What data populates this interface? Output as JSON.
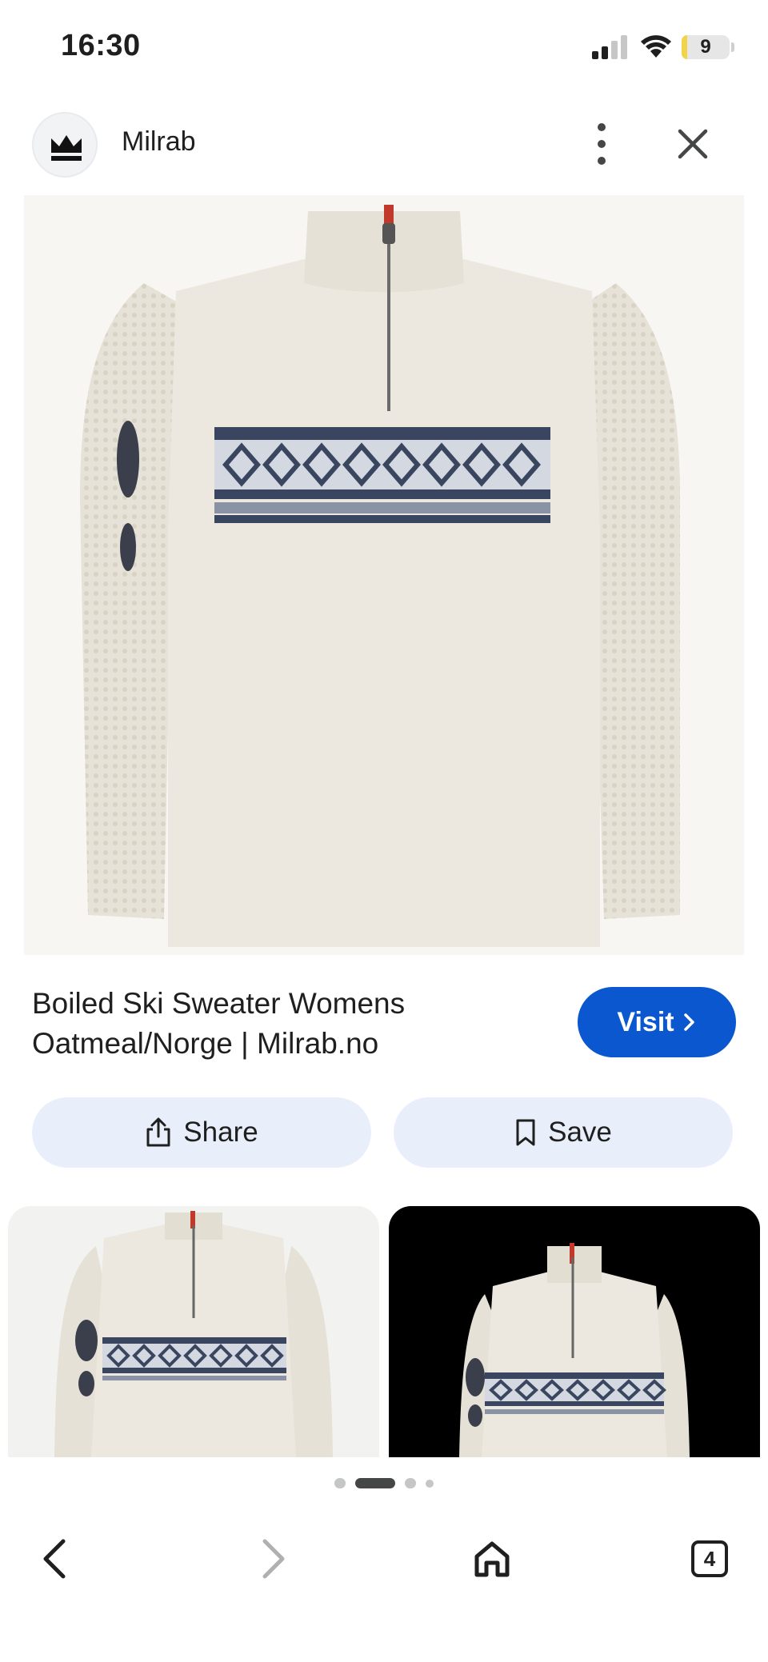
{
  "status_bar": {
    "time": "16:30",
    "battery_level": "9",
    "battery_fraction": 0.09
  },
  "header": {
    "site_name": "Milrab",
    "logo_icon": "mountain-crown-icon",
    "more_icon": "more-vertical-icon",
    "close_icon": "close-icon"
  },
  "result": {
    "title_line1": "Boiled Ski Sweater Womens",
    "title_line2": "Oatmeal/Norge | Milrab.no",
    "visit_label": "Visit",
    "visit_icon": "chevron-right-icon"
  },
  "actions": {
    "share_label": "Share",
    "share_icon": "share-icon",
    "save_label": "Save",
    "save_icon": "bookmark-icon"
  },
  "colors": {
    "accent": "#0b57d0",
    "action_bg": "#e8effb",
    "sweater": "#ece8df",
    "pattern": "#3a4660"
  },
  "pager": {
    "count": 4,
    "active_index": 1
  },
  "bottom_bar": {
    "back_icon": "chevron-left-icon",
    "forward_icon": "chevron-right-icon",
    "home_icon": "home-icon",
    "tabs_count": "4"
  }
}
